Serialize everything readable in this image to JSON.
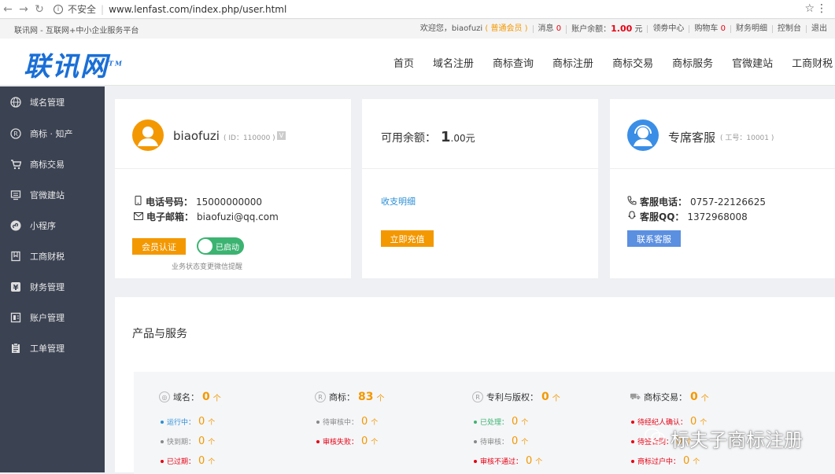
{
  "browser": {
    "security_label": "不安全",
    "url": "www.lenfast.com/index.php/user.html"
  },
  "topbar": {
    "slogan": "联讯网 - 互联网+中小企业服务平台",
    "welcome_prefix": "欢迎您，",
    "username": "biaofuzi",
    "member_level": "( 普通会员 )",
    "messages_label": "消息",
    "messages_count": "0",
    "balance_label": "账户余额：",
    "balance_value": "1.00",
    "balance_unit": "元",
    "coupon_center": "领劵中心",
    "cart_label": "购物车",
    "cart_count": "0",
    "finance_detail": "财务明细",
    "console": "控制台",
    "logout": "退出"
  },
  "header": {
    "logo_text": "联讯网",
    "logo_tm": "TM",
    "nav": [
      "首页",
      "域名注册",
      "商标查询",
      "商标注册",
      "商标交易",
      "商标服务",
      "官微建站",
      "工商财税"
    ]
  },
  "sidebar": {
    "items": [
      {
        "label": "域名管理",
        "icon": "globe-icon"
      },
      {
        "label": "商标 · 知产",
        "icon": "registered-icon"
      },
      {
        "label": "商标交易",
        "icon": "cart-icon"
      },
      {
        "label": "官微建站",
        "icon": "monitor-icon"
      },
      {
        "label": "小程序",
        "icon": "miniprogram-icon"
      },
      {
        "label": "工商财税",
        "icon": "bookmark-icon"
      },
      {
        "label": "财务管理",
        "icon": "yen-icon"
      },
      {
        "label": "账户管理",
        "icon": "account-icon"
      },
      {
        "label": "工单管理",
        "icon": "clipboard-icon"
      }
    ]
  },
  "user_card": {
    "name": "biaofuzi",
    "id_text": "( ID：110000 )",
    "vip_badge": "V",
    "phone_label": "电话号码：",
    "phone": "15000000000",
    "email_label": "电子邮箱：",
    "email": "biaofuzi@qq.com",
    "verify_button": "会员认证",
    "toggle_label": "已启动",
    "hint": "业务状态变更微信提醒"
  },
  "balance_card": {
    "label": "可用余额：",
    "value_int": "1",
    "value_dec": ".00元",
    "detail_link": "收支明细",
    "recharge_button": "立即充值"
  },
  "service_card": {
    "title": "专席客服",
    "job_id": "( 工号：10001 )",
    "phone_label": "客服电话：",
    "phone": "0757-22126625",
    "qq_label": "客服QQ：",
    "qq": "1372968008",
    "contact_button": "联系客服"
  },
  "products": {
    "title": "产品与服务",
    "columns": [
      {
        "label": "域名：",
        "count": "0",
        "unit": "个",
        "icon": "globe-icon",
        "rows": [
          {
            "label": "运行中：",
            "count": "0",
            "unit": "个",
            "color": "#2a8fd6"
          },
          {
            "label": "快到期：",
            "count": "0",
            "unit": "个",
            "color": "#888888"
          },
          {
            "label": "已过期：",
            "count": "0",
            "unit": "个",
            "color": "#e60012"
          }
        ]
      },
      {
        "label": "商标：",
        "count": "83",
        "unit": "个",
        "icon": "registered-icon",
        "rows": [
          {
            "label": "待审核中：",
            "count": "0",
            "unit": "个",
            "color": "#888888"
          },
          {
            "label": "审核失败：",
            "count": "0",
            "unit": "个",
            "color": "#e60012"
          }
        ]
      },
      {
        "label": "专利与版权：",
        "count": "0",
        "unit": "个",
        "icon": "registered-icon",
        "rows": [
          {
            "label": "已处理：",
            "count": "0",
            "unit": "个",
            "color": "#3cb371"
          },
          {
            "label": "待审核：",
            "count": "0",
            "unit": "个",
            "color": "#888888"
          },
          {
            "label": "审核不通过：",
            "count": "0",
            "unit": "个",
            "color": "#e60012"
          }
        ]
      },
      {
        "label": "商标交易：",
        "count": "0",
        "unit": "个",
        "icon": "cart-icon",
        "rows": [
          {
            "label": "待经纪人确认：",
            "count": "0",
            "unit": "个",
            "color": "#e60012"
          },
          {
            "label": "待签合同：",
            "count": "0",
            "unit": "个",
            "color": "#e60012"
          },
          {
            "label": "商标过户中：",
            "count": "0",
            "unit": "个",
            "color": "#e60012"
          }
        ]
      }
    ]
  },
  "watermark": "标夫子商标注册"
}
